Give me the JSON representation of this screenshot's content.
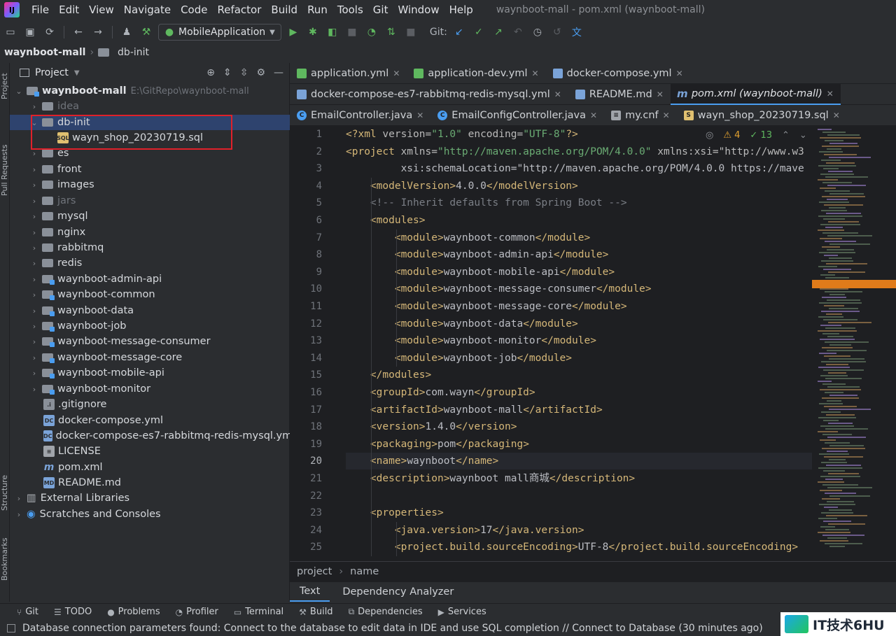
{
  "menubar": {
    "items": [
      "File",
      "Edit",
      "View",
      "Navigate",
      "Code",
      "Refactor",
      "Build",
      "Run",
      "Tools",
      "Git",
      "Window",
      "Help"
    ],
    "window_title": "waynboot-mall - pom.xml (waynboot-mall)"
  },
  "toolbar": {
    "run_config": "MobileApplication",
    "git_label": "Git:"
  },
  "navbar": {
    "project": "waynboot-mall",
    "folder": "db-init"
  },
  "left_stripe": {
    "project": "Project",
    "pull_requests": "Pull Requests",
    "structure": "Structure",
    "bookmarks": "Bookmarks"
  },
  "project_panel": {
    "title": "Project",
    "root_name": "waynboot-mall",
    "root_path": "E:\\GitRepo\\waynboot-mall",
    "items": [
      {
        "label": "idea",
        "type": "folder"
      },
      {
        "label": "db-init",
        "type": "folder"
      },
      {
        "label": "wayn_shop_20230719.sql",
        "type": "sql"
      },
      {
        "label": "es",
        "type": "folder"
      },
      {
        "label": "front",
        "type": "folder"
      },
      {
        "label": "images",
        "type": "folder"
      },
      {
        "label": "jars",
        "type": "folder"
      },
      {
        "label": "mysql",
        "type": "folder"
      },
      {
        "label": "nginx",
        "type": "folder"
      },
      {
        "label": "rabbitmq",
        "type": "folder"
      },
      {
        "label": "redis",
        "type": "folder"
      },
      {
        "label": "waynboot-admin-api",
        "type": "module"
      },
      {
        "label": "waynboot-common",
        "type": "module"
      },
      {
        "label": "waynboot-data",
        "type": "module"
      },
      {
        "label": "waynboot-job",
        "type": "module"
      },
      {
        "label": "waynboot-message-consumer",
        "type": "module"
      },
      {
        "label": "waynboot-message-core",
        "type": "module"
      },
      {
        "label": "waynboot-mobile-api",
        "type": "module"
      },
      {
        "label": "waynboot-monitor",
        "type": "module"
      },
      {
        "label": ".gitignore",
        "type": "git"
      },
      {
        "label": "docker-compose.yml",
        "type": "doc"
      },
      {
        "label": "docker-compose-es7-rabbitmq-redis-mysql.yml",
        "type": "doc"
      },
      {
        "label": "LICENSE",
        "type": "lic"
      },
      {
        "label": "pom.xml",
        "type": "m"
      },
      {
        "label": "README.md",
        "type": "md"
      }
    ],
    "external_libraries": "External Libraries",
    "scratches": "Scratches and Consoles"
  },
  "editor_tabs": {
    "row1": [
      {
        "label": "application.yml",
        "icon": "yml"
      },
      {
        "label": "application-dev.yml",
        "icon": "yml"
      },
      {
        "label": "docker-compose.yml",
        "icon": "doc"
      }
    ],
    "row2": [
      {
        "label": "docker-compose-es7-rabbitmq-redis-mysql.yml",
        "icon": "doc"
      },
      {
        "label": "README.md",
        "icon": "md"
      },
      {
        "label": "pom.xml (waynboot-mall)",
        "icon": "m"
      }
    ],
    "row3": [
      {
        "label": "EmailController.java",
        "icon": "java"
      },
      {
        "label": "EmailConfigController.java",
        "icon": "java"
      },
      {
        "label": "my.cnf",
        "icon": "cnf"
      },
      {
        "label": "wayn_shop_20230719.sql",
        "icon": "sql"
      }
    ]
  },
  "indicators": {
    "warnings": "4",
    "ok": "13"
  },
  "code": {
    "lines": [
      "<?xml version=\"1.0\" encoding=\"UTF-8\"?>",
      "<project xmlns=\"http://maven.apache.org/POM/4.0.0\" xmlns:xsi=\"http://www.w3",
      "         xsi:schemaLocation=\"http://maven.apache.org/POM/4.0.0 https://mave",
      "    <modelVersion>4.0.0</modelVersion>",
      "    <!-- Inherit defaults from Spring Boot -->",
      "    <modules>",
      "        <module>waynboot-common</module>",
      "        <module>waynboot-admin-api</module>",
      "        <module>waynboot-mobile-api</module>",
      "        <module>waynboot-message-consumer</module>",
      "        <module>waynboot-message-core</module>",
      "        <module>waynboot-data</module>",
      "        <module>waynboot-monitor</module>",
      "        <module>waynboot-job</module>",
      "    </modules>",
      "    <groupId>com.wayn</groupId>",
      "    <artifactId>waynboot-mall</artifactId>",
      "    <version>1.4.0</version>",
      "    <packaging>pom</packaging>",
      "    <name>waynboot</name>",
      "    <description>waynboot mall商城</description>",
      "",
      "    <properties>",
      "        <java.version>17</java.version>",
      "        <project.build.sourceEncoding>UTF-8</project.build.sourceEncoding>"
    ],
    "numbers": [
      "1",
      "2",
      "3",
      "4",
      "5",
      "6",
      "7",
      "8",
      "9",
      "10",
      "11",
      "12",
      "13",
      "14",
      "15",
      "16",
      "17",
      "18",
      "19",
      "20",
      "21",
      "22",
      "23",
      "24",
      "25"
    ]
  },
  "code_breadcrumbs": {
    "a": "project",
    "b": "name"
  },
  "xml_tabs": {
    "text": "Text",
    "dependency": "Dependency Analyzer"
  },
  "tool_windows": [
    "Git",
    "TODO",
    "Problems",
    "Profiler",
    "Terminal",
    "Build",
    "Dependencies",
    "Services"
  ],
  "status": {
    "message": "Database connection parameters found: Connect to the database to edit data in IDE and use SQL completion // Connect to Database (30 minutes ago)"
  },
  "watermark": {
    "text": "IT技术6HU"
  }
}
